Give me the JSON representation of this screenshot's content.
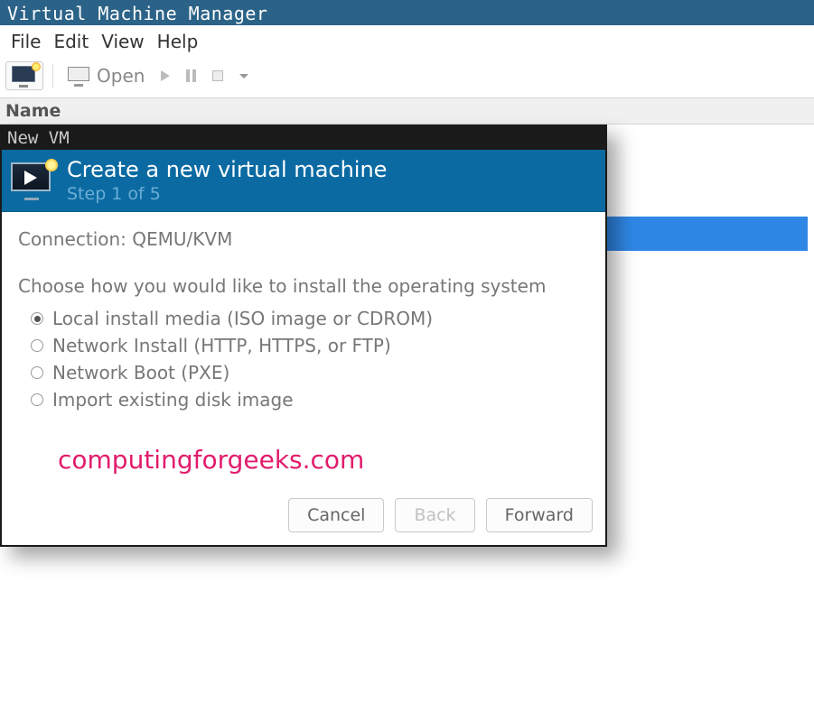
{
  "window": {
    "title": "Virtual Machine Manager"
  },
  "menubar": {
    "file": "File",
    "edit": "Edit",
    "view": "View",
    "help": "Help"
  },
  "toolbar": {
    "open": "Open"
  },
  "columns": {
    "name": "Name"
  },
  "dialog": {
    "title": "New VM",
    "banner_title": "Create a new virtual machine",
    "banner_step": "Step 1 of 5",
    "connection_label": "Connection: QEMU/KVM",
    "prompt": "Choose how you would like to install the operating system",
    "options": {
      "local": "Local install media (ISO image or CDROM)",
      "netinstall": "Network Install (HTTP, HTTPS, or FTP)",
      "pxe": "Network Boot (PXE)",
      "import": "Import existing disk image"
    },
    "selected": "local",
    "buttons": {
      "cancel": "Cancel",
      "back": "Back",
      "forward": "Forward"
    }
  },
  "watermark": "computingforgeeks.com"
}
